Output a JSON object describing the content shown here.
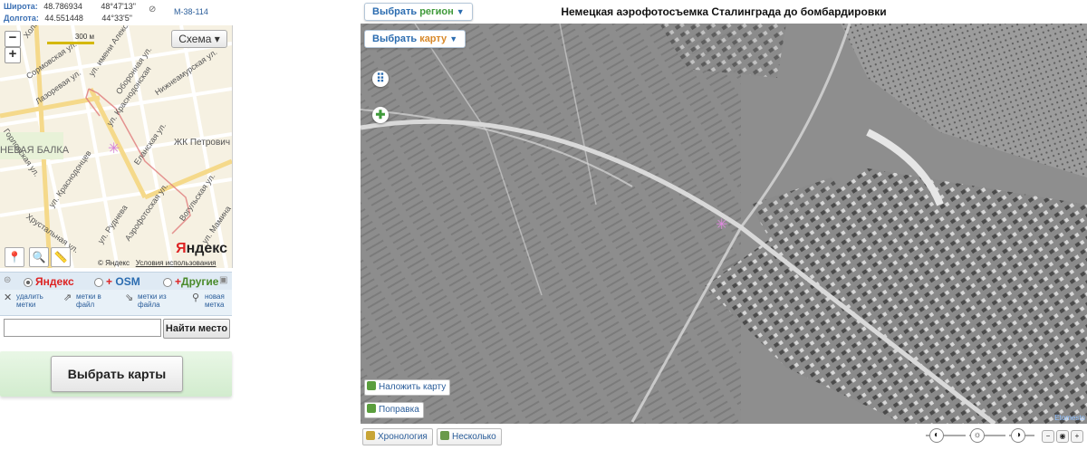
{
  "coords": {
    "lat_label": "Широта:",
    "lat_value": "48.786934",
    "lat_dms": "48°47'13\"",
    "lon_label": "Долгота:",
    "lon_value": "44.551448",
    "lon_dms": "44°33'5\"",
    "sheet": "M-38-114"
  },
  "mini_map": {
    "zoom_out": "−",
    "zoom_in": "+",
    "scale_label": "300 м",
    "schema_label": "Схема ▾",
    "streets": [
      "Хользунова ул.",
      "Сормовская ул.",
      "Горловская ул.",
      "Лазоревая ул.",
      "ул. имени Александра Н.",
      "Оборонная ул.",
      "Нижнеамурская ул.",
      "ул. Краснодонская",
      "Еланская ул.",
      "ЖК Петрович",
      "НЕВАЯ БАЛКА",
      "ул. Краснодонцев",
      "Хрустальная ул.",
      "ул. Руднева",
      "Аэрофотоская ул.",
      "Вогульская ул.",
      "ул. Мамина"
    ],
    "logo_main": "Я",
    "logo_rest": "ндекс",
    "copyright": "© Яндекс",
    "terms": "Условия использования"
  },
  "providers": {
    "yandex": "Яндекс",
    "osm": "OSM",
    "other": "Другие"
  },
  "marks": [
    {
      "label1": "удалить",
      "label2": "метки"
    },
    {
      "label1": "метки в",
      "label2": "файл"
    },
    {
      "label1": "метки из",
      "label2": "файла"
    },
    {
      "label1": "новая",
      "label2": "метка"
    }
  ],
  "search": {
    "value": "",
    "button": "Найти место"
  },
  "choose_maps": "Выбрать карты",
  "right": {
    "title": "Немецкая аэрофотосъемка Сталинграда до бомбардировки",
    "region_btn_w1": "Выбрать",
    "region_btn_w2": "регион",
    "map_btn_w1": "Выбрать",
    "map_btn_w2": "карту",
    "overlay_link": "Наложить карту",
    "fix_link": "Поправка",
    "chronology": "Хронология",
    "several": "Несколько",
    "credit": "Etomesto"
  },
  "colors": {
    "accent_blue": "#2b6cb0",
    "accent_orange": "#c65",
    "green_btn_bg": "#d2ecce"
  }
}
